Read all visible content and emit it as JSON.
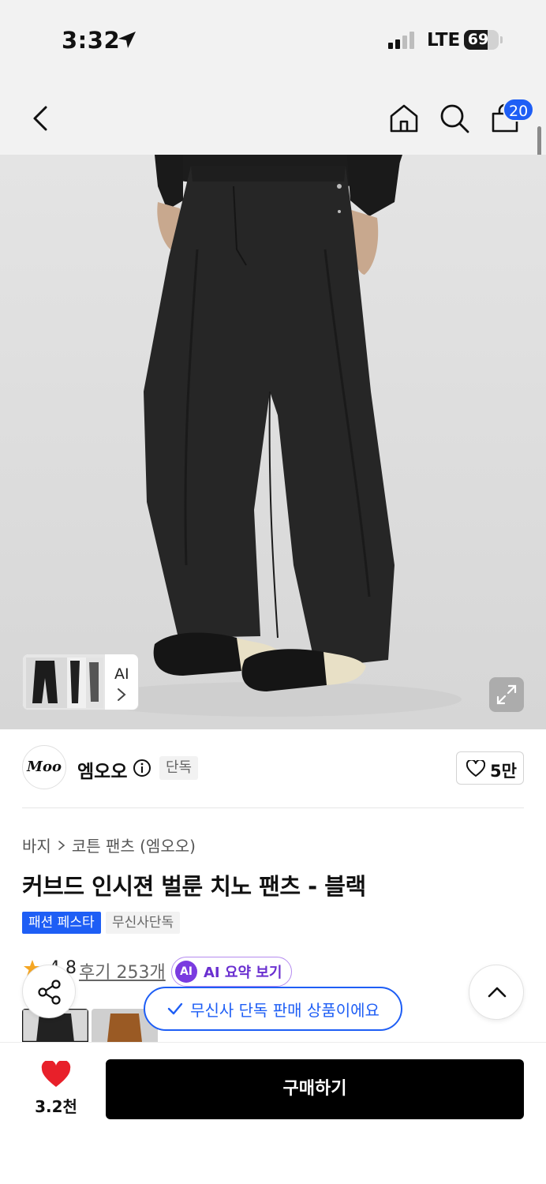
{
  "status_bar": {
    "time": "3:32",
    "network": "LTE",
    "battery": "69",
    "battery_level": 0.69
  },
  "nav": {
    "cart_count": "20",
    "icons": [
      "back-chevron-icon",
      "home-icon",
      "search-icon",
      "cart-bag-icon"
    ]
  },
  "gallery": {
    "ai_label": "AI",
    "icons": [
      "chevron-right-icon",
      "expand-icon"
    ]
  },
  "brand": {
    "logo_text": "Moo",
    "name": "엠오오",
    "exclusive_tag": "단독",
    "like_count": "5만"
  },
  "product": {
    "breadcrumb": [
      "바지",
      "코튼 팬츠 (엠오오)"
    ],
    "title": "커브드 인시젼 벌룬 치노 팬츠 - 블랙",
    "tags": [
      "패션 페스타",
      "무신사단독"
    ],
    "rating": "4.8",
    "review_link": "후기 253개",
    "ai_badge": "AI",
    "ai_summary": "AI 요약 보기"
  },
  "toast": {
    "message": "무신사 단독 판매 상품이에요"
  },
  "bottom": {
    "wish_count": "3.2천",
    "buy_label": "구매하기"
  },
  "colors": {
    "accent_blue": "#1e5ef5",
    "ai_purple": "#7a3be0",
    "heart_red": "#e8202a",
    "buy_button": "#000000",
    "rating_star": "#f5a623"
  }
}
